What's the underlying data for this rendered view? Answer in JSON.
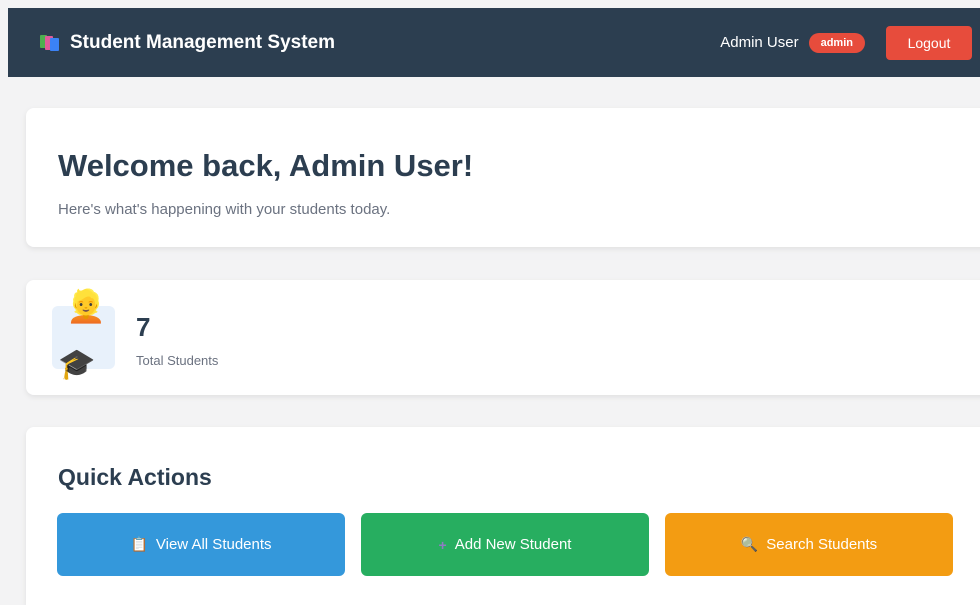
{
  "navbar": {
    "title": "Student Management System",
    "user_name": "Admin User",
    "role": "admin",
    "logout_label": "Logout"
  },
  "welcome": {
    "heading": "Welcome back, Admin User!",
    "subtitle": "Here's what's happening with your students today."
  },
  "stats": {
    "total_students_value": "7",
    "total_students_label": "Total Students",
    "icon_face": "👱",
    "icon_cap": "🎓"
  },
  "quick_actions": {
    "heading": "Quick Actions",
    "view_all_label": "View All Students",
    "view_all_icon": "📋",
    "add_new_label": "Add New Student",
    "add_new_icon": "+",
    "search_label": "Search Students",
    "search_icon": "🔍"
  },
  "colors": {
    "navbar": "#2c3e50",
    "danger": "#e74c3c",
    "primary": "#3498db",
    "success": "#27ae60",
    "warning": "#f39c12"
  }
}
